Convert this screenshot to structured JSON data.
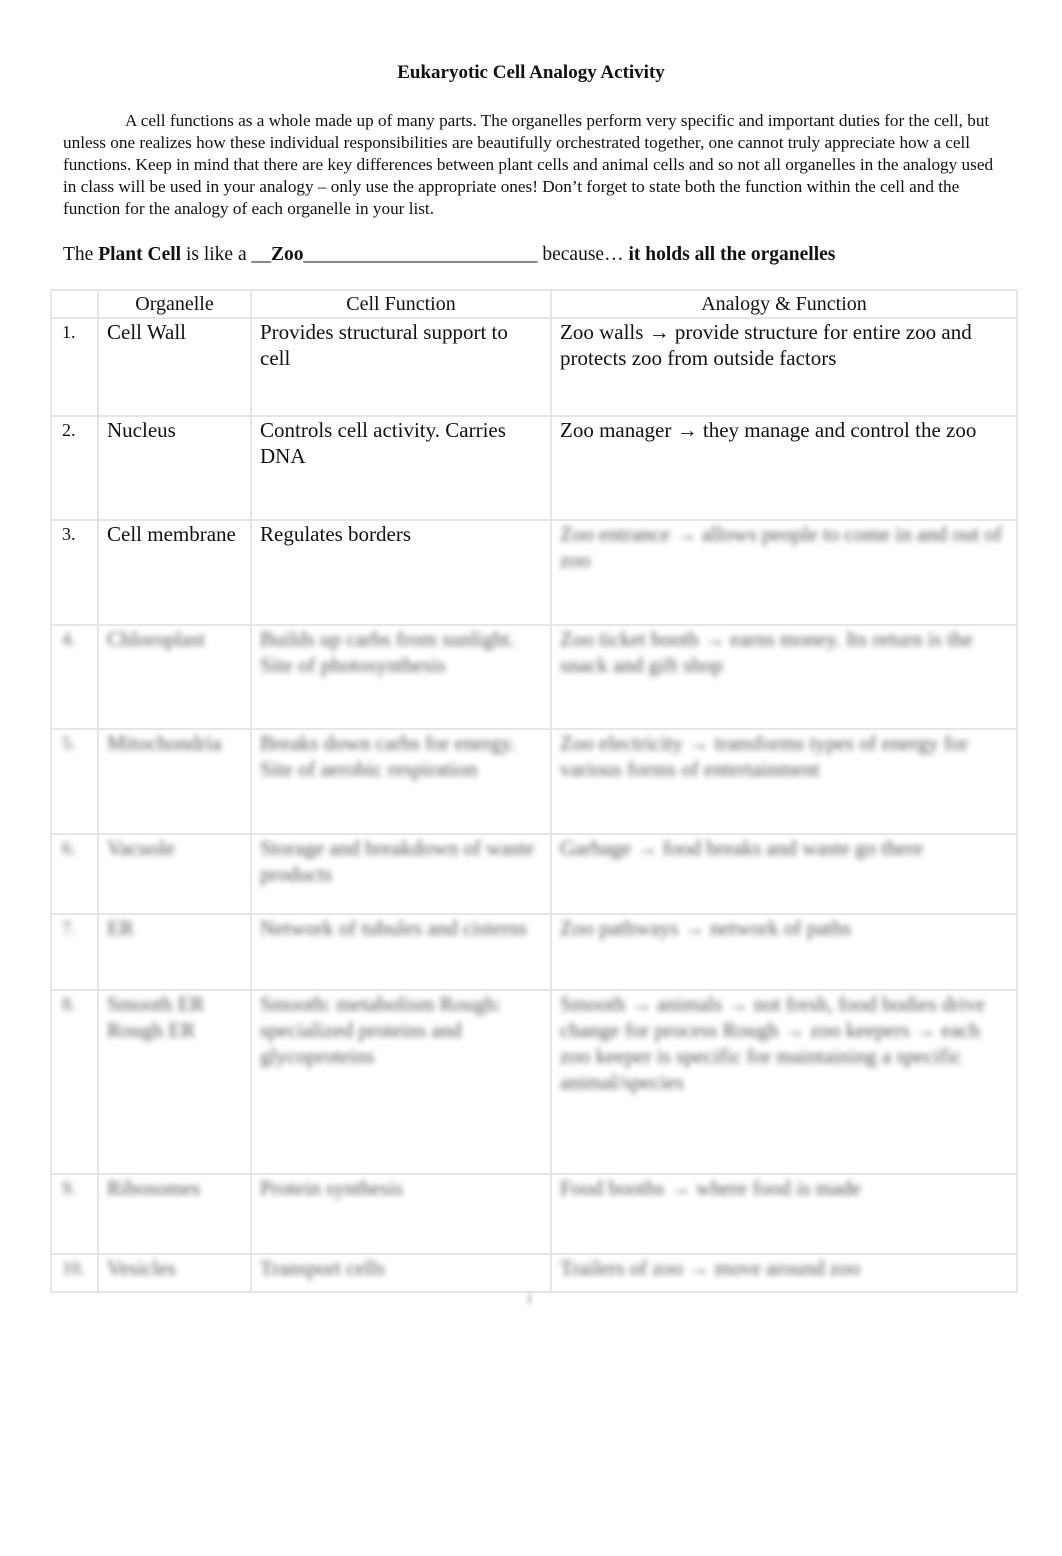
{
  "title": "Eukaryotic Cell Analogy Activity",
  "intro": "A cell functions as a whole made up of many parts.  The organelles perform very specific and important duties for the cell, but unless one realizes how these individual responsibilities are beautifully orchestrated together, one cannot truly appreciate how a cell functions. Keep in mind that there are key differences between plant cells and animal cells and so not all organelles in the analogy used in class will be used in your analogy – only use the appropriate ones!  Don’t forget to state both the function within the cell and the function for the analogy of each organelle in your list.",
  "statement": {
    "prefix": "The ",
    "subject": "Plant Cell",
    "middle": " is like a __",
    "answer": "Zoo",
    "blank": "________________________",
    "because": " because… ",
    "reason": "it holds all the organelles"
  },
  "table": {
    "headers": [
      "",
      "Organelle",
      "Cell Function",
      "Analogy & Function"
    ],
    "rows": [
      {
        "num": "1.",
        "organelle": "Cell Wall",
        "function": "Provides structural support to cell",
        "analogy": "Zoo walls → provide structure for entire zoo and protects zoo from outside factors",
        "blurred": false,
        "analogy_blurred": false
      },
      {
        "num": "2.",
        "organelle": "Nucleus",
        "function": "Controls cell activity. Carries DNA",
        "analogy": "Zoo manager → they manage and control the zoo",
        "blurred": false,
        "analogy_blurred": false
      },
      {
        "num": "3.",
        "organelle": "Cell membrane",
        "function": "Regulates borders",
        "analogy": "Zoo entrance → allows people to come in and out of zoo",
        "blurred": false,
        "analogy_blurred": true
      },
      {
        "num": "4.",
        "organelle": "Chloroplast",
        "function": "Builds up carbs from sunlight. Site of photosynthesis",
        "analogy": "Zoo ticket booth → earns money. Its return is the snack and gift shop",
        "blurred": true
      },
      {
        "num": "5.",
        "organelle": "Mitochondria",
        "function": "Breaks down carbs for energy. Site of aerobic respiration",
        "analogy": "Zoo electricity → transforms types of energy for various forms of entertainment",
        "blurred": true
      },
      {
        "num": "6.",
        "organelle": "Vacuole",
        "function": "Storage and breakdown of waste products",
        "analogy": "Garbage → food breaks and waste go there",
        "blurred": true
      },
      {
        "num": "7.",
        "organelle": "ER",
        "function": "Network of tubules and cisterns",
        "analogy": "Zoo pathways → network of paths",
        "blurred": true
      },
      {
        "num": "8.",
        "organelle": "Smooth ER Rough ER",
        "function": "Smooth: metabolism Rough: specialized proteins and glycoproteins",
        "analogy": "Smooth → animals → not fresh, food bodies drive change for process Rough → zoo keepers → each zoo keeper is specific for maintaining a specific animal/species",
        "blurred": true
      },
      {
        "num": "9.",
        "organelle": "Ribosomes",
        "function": "Protein synthesis",
        "analogy": "Food booths → where food is made",
        "blurred": true
      },
      {
        "num": "10.",
        "organelle": "Vesicles",
        "function": "Transport cells",
        "analogy": "Trailers of zoo → move around zoo",
        "blurred": true
      }
    ]
  },
  "page_number": "1"
}
